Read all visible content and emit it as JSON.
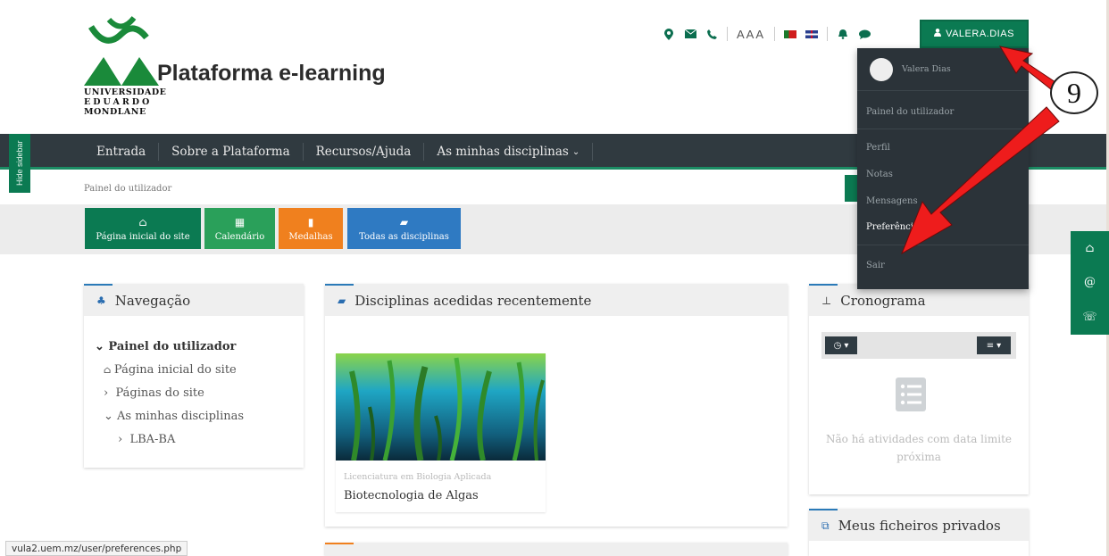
{
  "brand": {
    "title": "Plataforma e-learning",
    "university_lines": [
      "UNIVERSIDADE",
      "EDUARDO",
      "MONDLANE"
    ]
  },
  "header": {
    "font_size_label": "AAA",
    "user_button_label": "VALERA.DIAS"
  },
  "nav": {
    "items": [
      "Entrada",
      "Sobre a Plataforma",
      "Recursos/Ajuda",
      "As minhas disciplinas"
    ],
    "hide_sidebar": "Hide sidebar"
  },
  "breadcrumb": "Painel do utilizador",
  "quick_buttons": [
    {
      "label": "Página inicial do site",
      "icon": "home-icon",
      "color": "#0b7a52"
    },
    {
      "label": "Calendário",
      "icon": "calendar-icon",
      "color": "#2aa05a"
    },
    {
      "label": "Medalhas",
      "icon": "bookmark-icon",
      "color": "#f0801e"
    },
    {
      "label": "Todas as disciplinas",
      "icon": "book-icon",
      "color": "#2f7ac2"
    }
  ],
  "navigation_block": {
    "title": "Navegação",
    "tree": [
      {
        "label": "Painel do utilizador",
        "level": 0
      },
      {
        "label": "Página inicial do site",
        "level": 1
      },
      {
        "label": "Páginas do site",
        "level": 1
      },
      {
        "label": "As minhas disciplinas",
        "level": 1
      },
      {
        "label": "LBA-BA",
        "level": 2
      }
    ]
  },
  "recent_block": {
    "title": "Disciplinas acedidas recentemente",
    "course": {
      "category": "Licenciatura em Biologia Aplicada",
      "name": "Biotecnologia de Algas"
    }
  },
  "timeline_block": {
    "title": "Cronograma",
    "empty_message": "Não há atividades com data limite próxima"
  },
  "files_block": {
    "title": "Meus ficheiros privados"
  },
  "user_menu": {
    "name": "Valera Dias",
    "items": [
      "Painel do utilizador",
      "Perfil",
      "Notas",
      "Mensagens",
      "Preferências",
      "Sair"
    ]
  },
  "annotation": {
    "step": "9"
  },
  "status_url": "vula2.uem.mz/user/preferences.php",
  "colors": {
    "brand_green": "#0b7a52",
    "nav_dark": "#303a40",
    "arrow_red": "#ee1c1c"
  }
}
